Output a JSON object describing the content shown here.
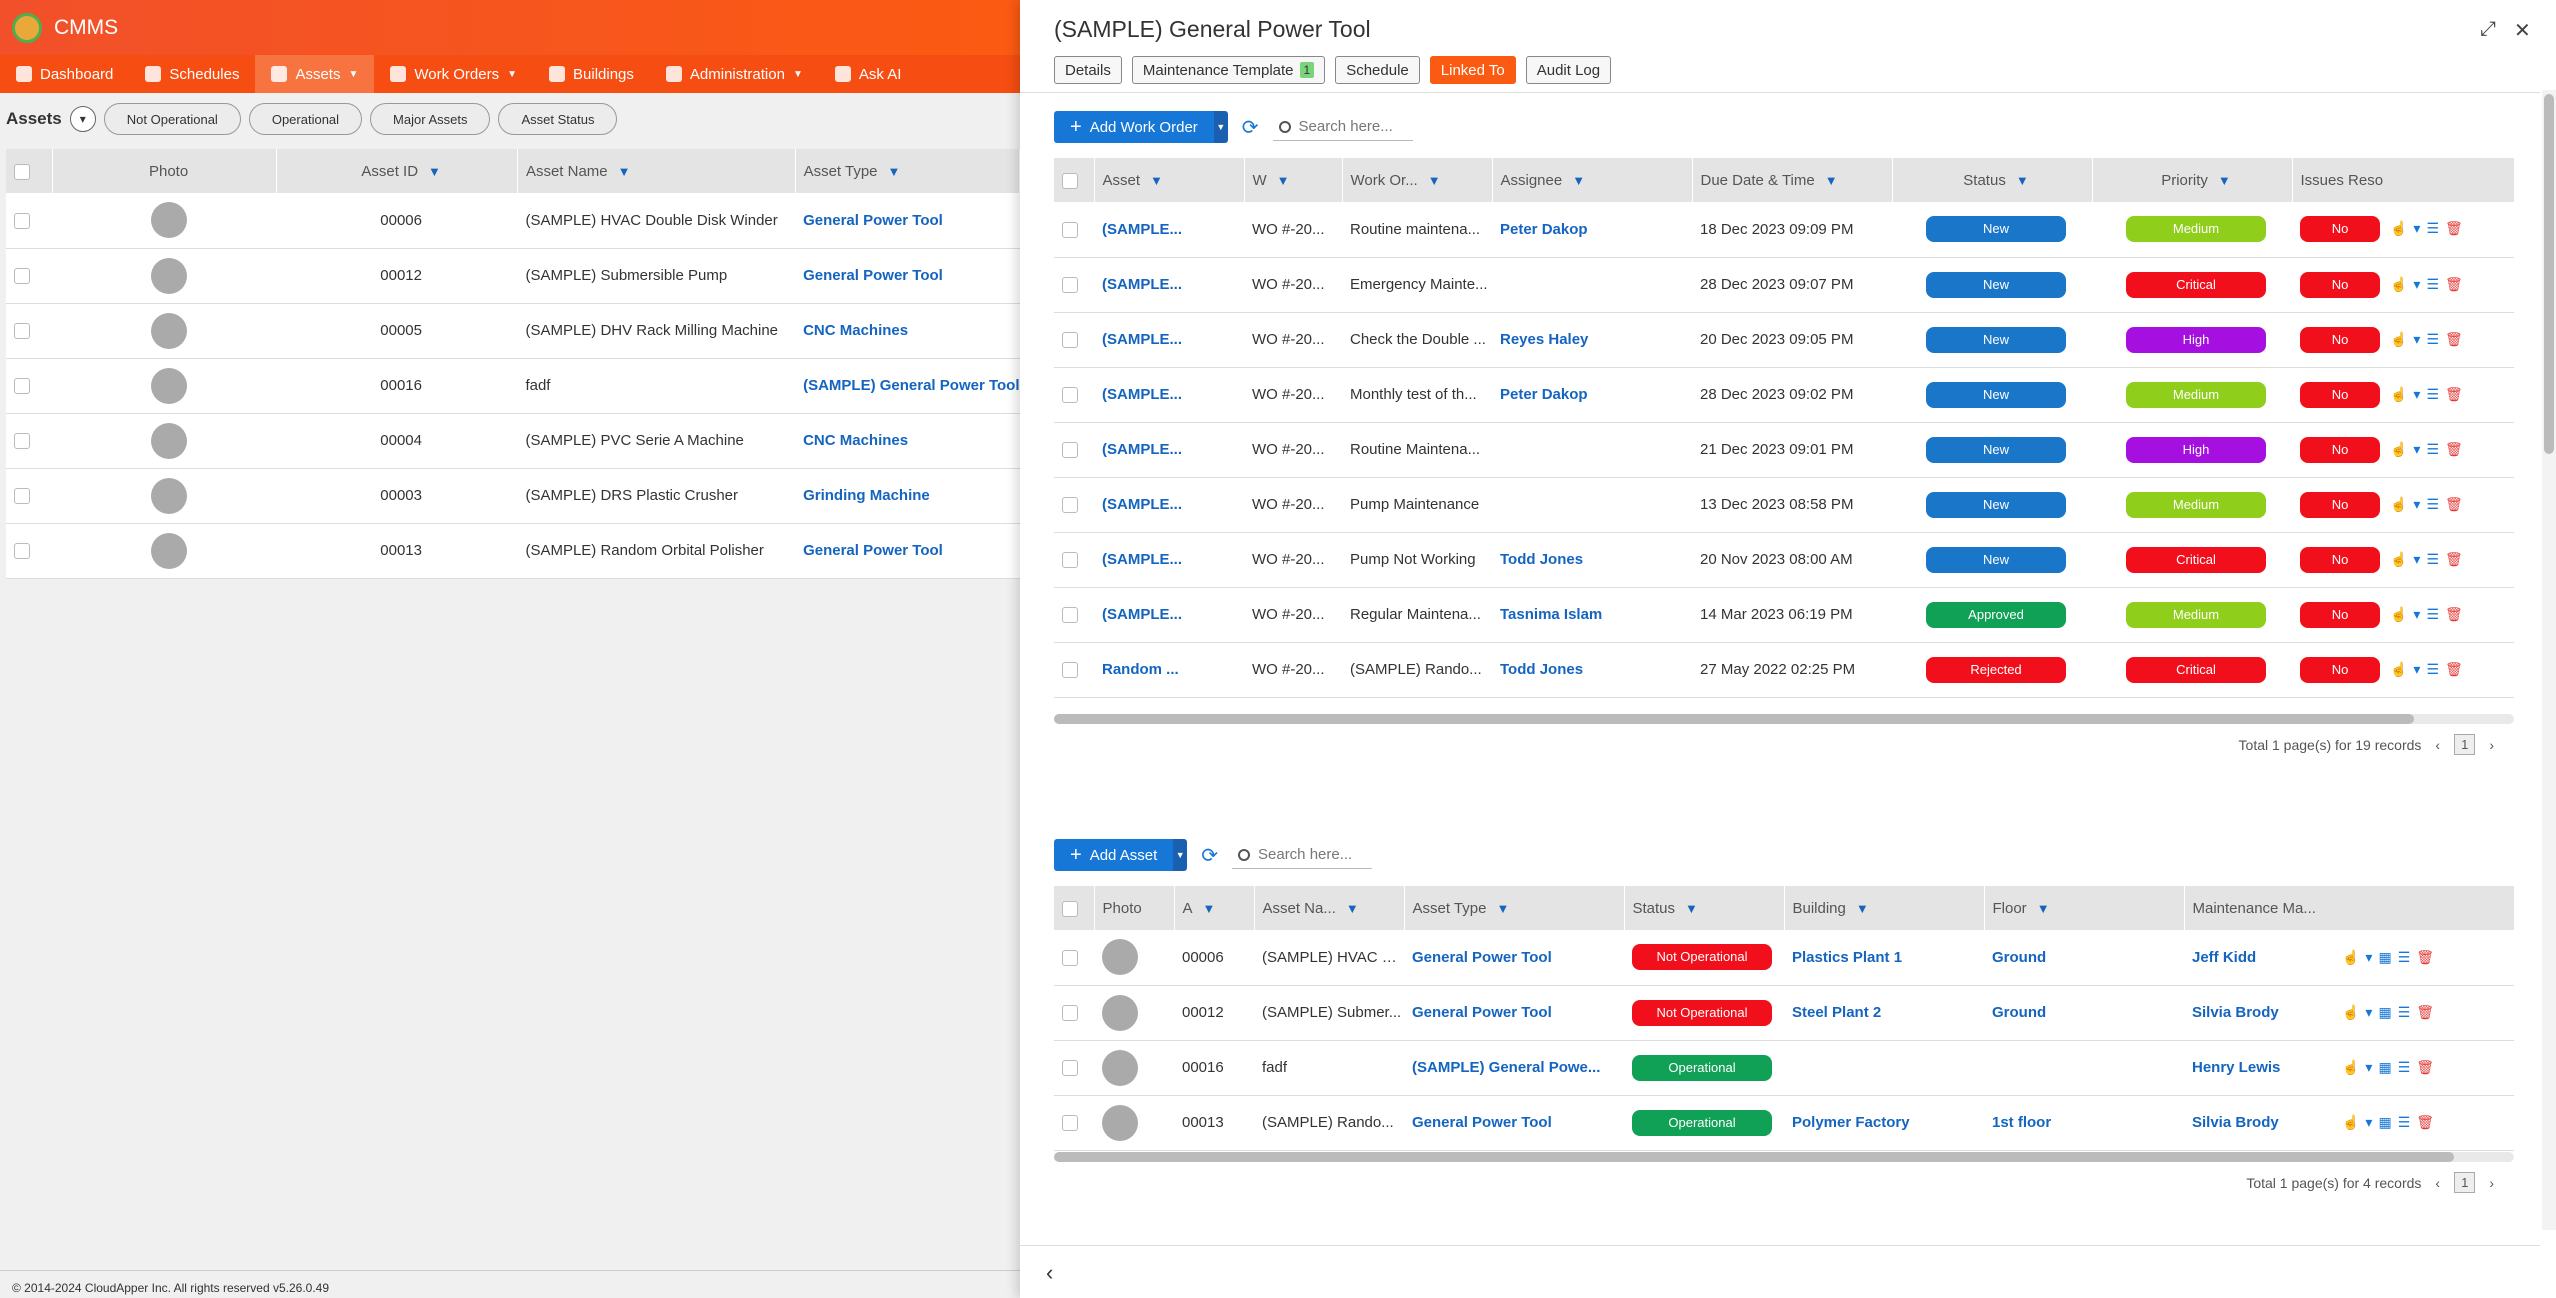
{
  "app": {
    "title": "CMMS"
  },
  "nav": [
    {
      "label": "Dashboard"
    },
    {
      "label": "Schedules"
    },
    {
      "label": "Assets",
      "active": true
    },
    {
      "label": "Work Orders"
    },
    {
      "label": "Buildings"
    },
    {
      "label": "Administration"
    },
    {
      "label": "Ask AI"
    }
  ],
  "assets_page": {
    "title": "Assets",
    "filters": [
      "Not Operational",
      "Operational",
      "Major Assets",
      "Asset Status"
    ],
    "columns": [
      "Photo",
      "Asset ID",
      "Asset Name",
      "Asset Type"
    ],
    "rows": [
      {
        "id": "00006",
        "name": "(SAMPLE) HVAC Double Disk Winder",
        "type": "General Power Tool"
      },
      {
        "id": "00012",
        "name": "(SAMPLE) Submersible Pump",
        "type": "General Power Tool"
      },
      {
        "id": "00005",
        "name": "(SAMPLE) DHV Rack Milling Machine",
        "type": "CNC Machines"
      },
      {
        "id": "00016",
        "name": "fadf",
        "type": "(SAMPLE) General Power Tool"
      },
      {
        "id": "00004",
        "name": "(SAMPLE) PVC Serie A Machine",
        "type": "CNC Machines"
      },
      {
        "id": "00003",
        "name": "(SAMPLE) DRS Plastic Crusher",
        "type": "Grinding Machine"
      },
      {
        "id": "00013",
        "name": "(SAMPLE) Random Orbital Polisher",
        "type": "General Power Tool"
      }
    ],
    "footer": "© 2014-2024 CloudApper Inc. All rights reserved v5.26.0.49"
  },
  "drawer": {
    "title": "(SAMPLE) General Power Tool",
    "tabs": [
      {
        "label": "Details"
      },
      {
        "label": "Maintenance Template",
        "count": "1"
      },
      {
        "label": "Schedule"
      },
      {
        "label": "Linked To",
        "active": true
      },
      {
        "label": "Audit Log"
      }
    ],
    "wo_section": {
      "add_label": "Add Work Order",
      "search_placeholder": "Search here...",
      "columns": [
        "Asset",
        "W",
        "Work Or...",
        "Assignee",
        "Due Date & Time",
        "Status",
        "Priority",
        "Issues Reso"
      ],
      "rows": [
        {
          "asset": "(SAMPLE...",
          "wo": "WO #-20...",
          "work": "Routine maintena...",
          "assignee": "Peter Dakop",
          "due": "18 Dec 2023 09:09 PM",
          "status": "New",
          "priority": "Medium"
        },
        {
          "asset": "(SAMPLE...",
          "wo": "WO #-20...",
          "work": "Emergency Mainte...",
          "assignee": "",
          "due": "28 Dec 2023 09:07 PM",
          "status": "New",
          "priority": "Critical"
        },
        {
          "asset": "(SAMPLE...",
          "wo": "WO #-20...",
          "work": "Check the Double ...",
          "assignee": "Reyes Haley",
          "due": "20 Dec 2023 09:05 PM",
          "status": "New",
          "priority": "High"
        },
        {
          "asset": "(SAMPLE...",
          "wo": "WO #-20...",
          "work": "Monthly test of th...",
          "assignee": "Peter Dakop",
          "due": "28 Dec 2023 09:02 PM",
          "status": "New",
          "priority": "Medium"
        },
        {
          "asset": "(SAMPLE...",
          "wo": "WO #-20...",
          "work": "Routine Maintena...",
          "assignee": "",
          "due": "21 Dec 2023 09:01 PM",
          "status": "New",
          "priority": "High"
        },
        {
          "asset": "(SAMPLE...",
          "wo": "WO #-20...",
          "work": "Pump Maintenance",
          "assignee": "",
          "due": "13 Dec 2023 08:58 PM",
          "status": "New",
          "priority": "Medium"
        },
        {
          "asset": "(SAMPLE...",
          "wo": "WO #-20...",
          "work": "Pump Not Working",
          "assignee": "Todd Jones",
          "due": "20 Nov 2023 08:00 AM",
          "status": "New",
          "priority": "Critical"
        },
        {
          "asset": "(SAMPLE...",
          "wo": "WO #-20...",
          "work": "Regular Maintena...",
          "assignee": "Tasnima Islam",
          "due": "14 Mar 2023 06:19 PM",
          "status": "Approved",
          "priority": "Medium"
        },
        {
          "asset": "Random ...",
          "wo": "WO #-20...",
          "work": "(SAMPLE) Rando...",
          "assignee": "Todd Jones",
          "due": "27 May 2022 02:25 PM",
          "status": "Rejected",
          "priority": "Critical"
        }
      ],
      "issue_badge": "No",
      "pager_text": "Total 1 page(s) for 19 records",
      "page": "1"
    },
    "asset_section": {
      "add_label": "Add Asset",
      "search_placeholder": "Search here...",
      "columns": [
        "Photo",
        "A",
        "Asset Na...",
        "Asset Type",
        "Status",
        "Building",
        "Floor",
        "Maintenance Ma..."
      ],
      "rows": [
        {
          "id": "00006",
          "name": "(SAMPLE) HVAC D...",
          "type": "General Power Tool",
          "status": "Not Operational",
          "building": "Plastics Plant 1",
          "floor": "Ground",
          "manager": "Jeff Kidd"
        },
        {
          "id": "00012",
          "name": "(SAMPLE) Submer...",
          "type": "General Power Tool",
          "status": "Not Operational",
          "building": "Steel Plant 2",
          "floor": "Ground",
          "manager": "Silvia Brody"
        },
        {
          "id": "00016",
          "name": "fadf",
          "type": "(SAMPLE) General Powe...",
          "status": "Operational",
          "building": "",
          "floor": "",
          "manager": "Henry Lewis"
        },
        {
          "id": "00013",
          "name": "(SAMPLE) Rando...",
          "type": "General Power Tool",
          "status": "Operational",
          "building": "Polymer Factory",
          "floor": "1st floor",
          "manager": "Silvia Brody"
        }
      ],
      "pager_text": "Total 1 page(s) for 4 records",
      "page": "1"
    }
  },
  "colors": {
    "new": "#1976c9",
    "approved": "#10a056",
    "rejected": "#f20f1c",
    "medium": "#8fce1a",
    "critical": "#f20f1c",
    "high": "#a510e0",
    "not_operational": "#f20f1c",
    "operational": "#10a056"
  }
}
